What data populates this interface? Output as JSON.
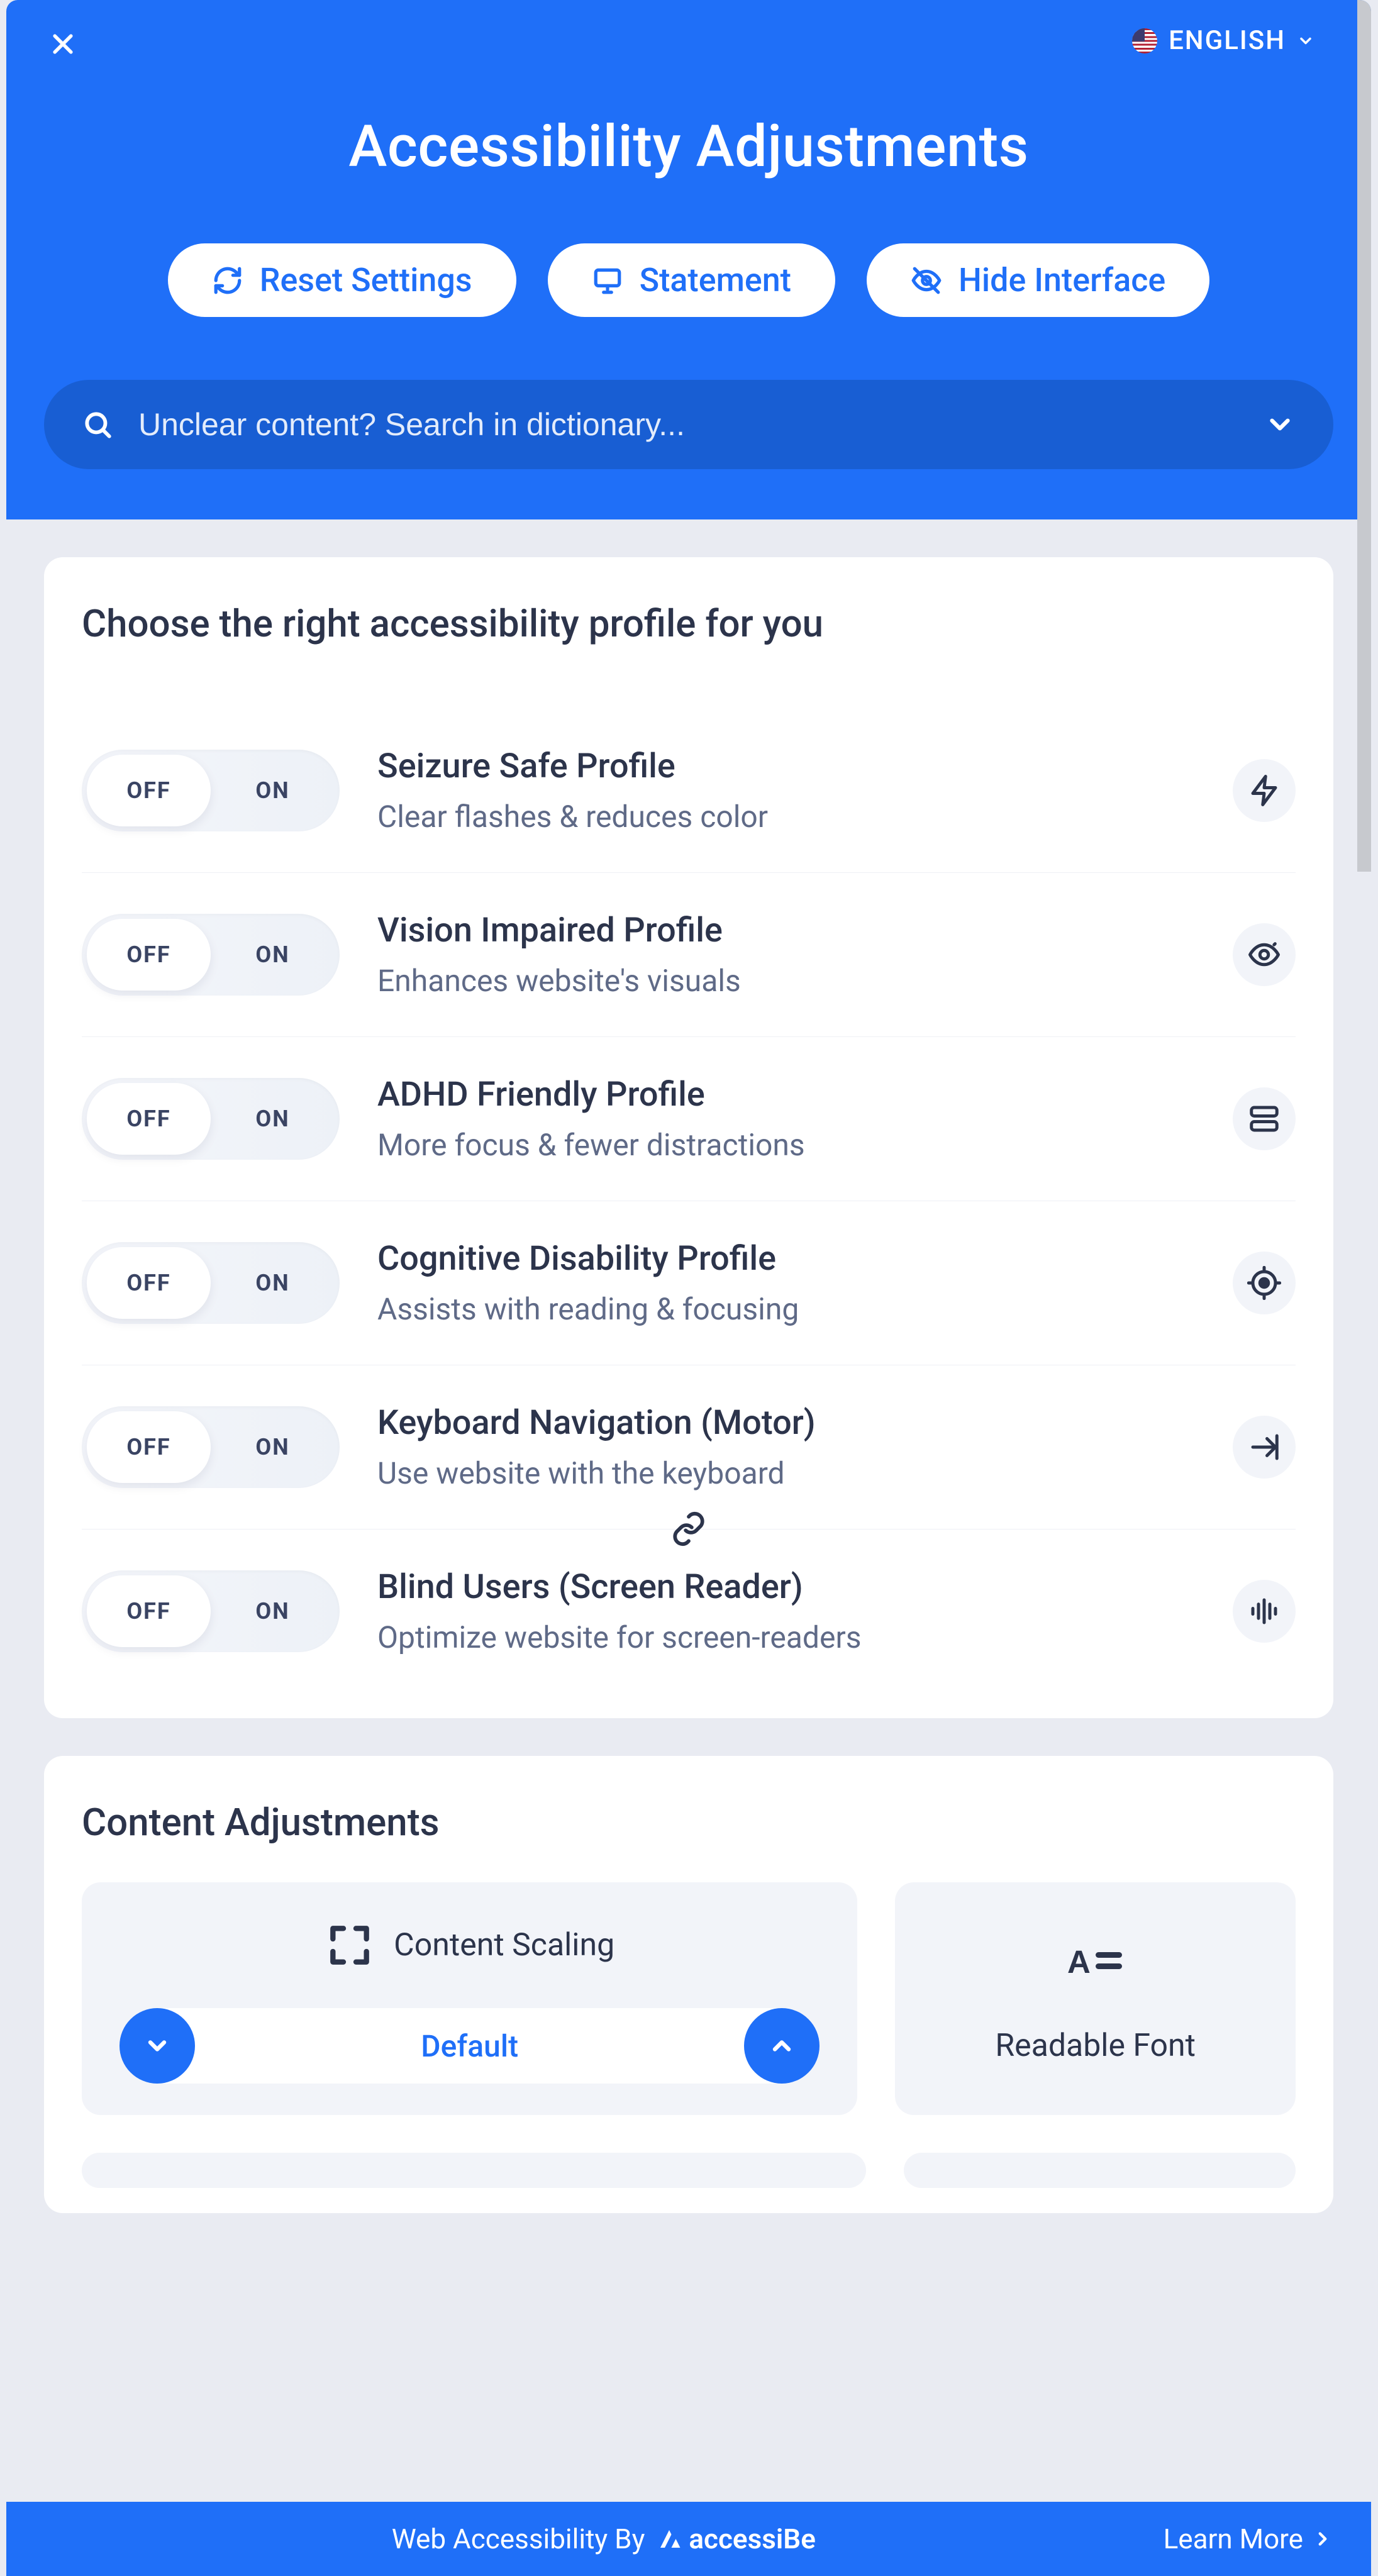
{
  "header": {
    "language": "ENGLISH",
    "title": "Accessibility Adjustments",
    "buttons": {
      "reset": "Reset Settings",
      "statement": "Statement",
      "hide": "Hide Interface"
    },
    "search_placeholder": "Unclear content? Search in dictionary..."
  },
  "profiles": {
    "section_title": "Choose the right accessibility profile for you",
    "off": "OFF",
    "on": "ON",
    "items": [
      {
        "title": "Seizure Safe Profile",
        "sub": "Clear flashes & reduces color",
        "icon": "bolt"
      },
      {
        "title": "Vision Impaired Profile",
        "sub": "Enhances website's visuals",
        "icon": "eye"
      },
      {
        "title": "ADHD Friendly Profile",
        "sub": "More focus & fewer distractions",
        "icon": "frame"
      },
      {
        "title": "Cognitive Disability Profile",
        "sub": "Assists with reading & focusing",
        "icon": "target"
      },
      {
        "title": "Keyboard Navigation (Motor)",
        "sub": "Use website with the keyboard",
        "icon": "tab",
        "linked_below": true
      },
      {
        "title": "Blind Users (Screen Reader)",
        "sub": "Optimize website for screen-readers",
        "icon": "sound"
      }
    ]
  },
  "content_adjust": {
    "section_title": "Content Adjustments",
    "scaling_label": "Content Scaling",
    "scaling_value": "Default",
    "readable_font": "Readable Font"
  },
  "footer": {
    "text": "Web Accessibility By",
    "brand": "accessiBe",
    "learn": "Learn More"
  }
}
